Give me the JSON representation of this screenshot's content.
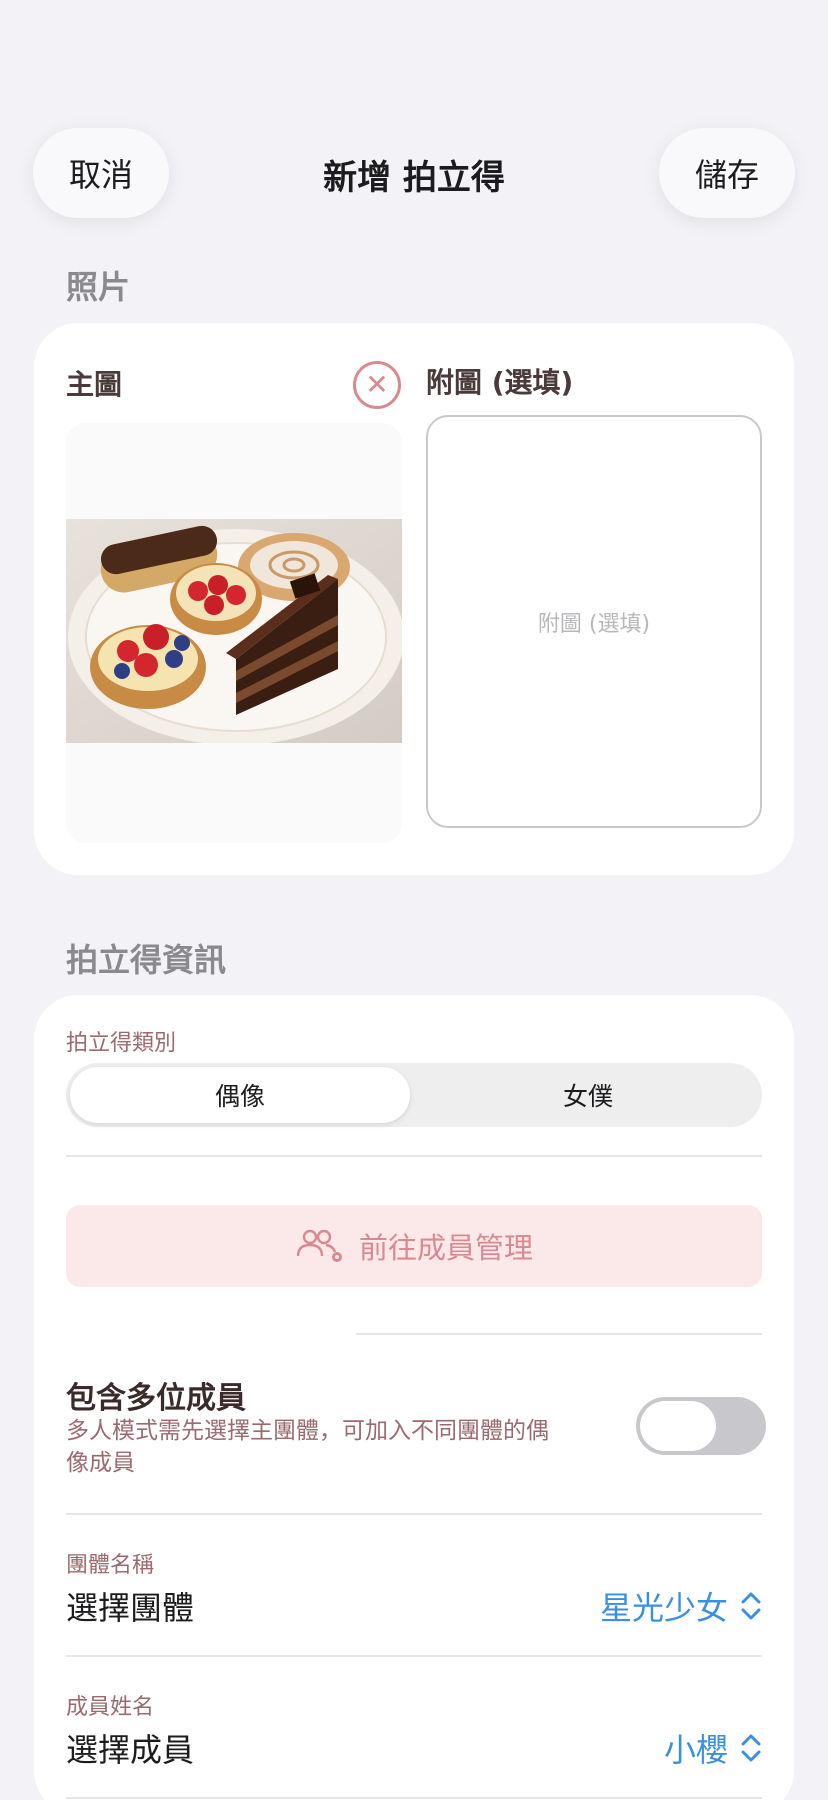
{
  "nav": {
    "cancel_label": "取消",
    "title": "新增 拍立得",
    "save_label": "儲存"
  },
  "photos": {
    "section_header": "照片",
    "main_label": "主圖",
    "sub_label": "附圖 (選填)",
    "sub_placeholder": "附圖 (選填)",
    "remove_symbol": "✕"
  },
  "info": {
    "section_header": "拍立得資訊",
    "category_caption": "拍立得類別",
    "category_options": [
      "偶像",
      "女僕"
    ],
    "category_selected": "偶像",
    "member_mgmt_label": "前往成員管理",
    "multi_member": {
      "title": "包含多位成員",
      "description": "多人模式需先選擇主團體，可加入不同團體的偶像成員",
      "enabled": false
    },
    "group": {
      "caption": "團體名稱",
      "label": "選擇團體",
      "value": "星光少女"
    },
    "member": {
      "caption": "成員姓名",
      "label": "選擇成員",
      "value": "小櫻"
    }
  },
  "colors": {
    "accent_pink": "#d98a90",
    "link_blue": "#3a8fe0",
    "background": "#f2f2f7"
  }
}
